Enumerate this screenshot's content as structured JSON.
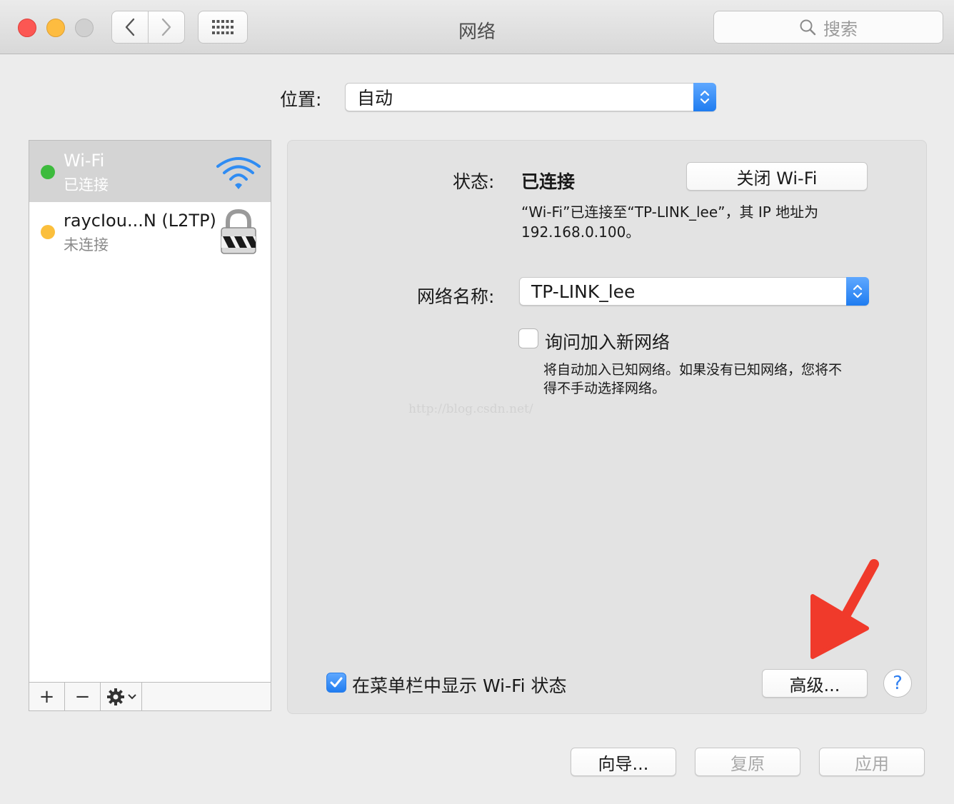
{
  "window": {
    "title": "网络",
    "search_placeholder": "搜索"
  },
  "location": {
    "label": "位置:",
    "value": "自动"
  },
  "services": [
    {
      "name": "Wi-Fi",
      "status": "已连接",
      "status_color": "#3dbb3d",
      "selected": true,
      "icon": "wifi-icon"
    },
    {
      "name": "raycIou...N (L2TP)",
      "status": "未连接",
      "status_color": "#fbbf3c",
      "selected": false,
      "icon": "lock-icon"
    }
  ],
  "sidebar_toolbar": {
    "add": "+",
    "remove": "−"
  },
  "detail": {
    "status_label": "状态:",
    "status_value": "已连接",
    "turn_off_button": "关闭 Wi-Fi",
    "status_description_line1": "“Wi-Fi”已连接至“TP-LINK_lee”，其 IP 地址为",
    "status_description_line2": "192.168.0.100。",
    "network_name_label": "网络名称:",
    "network_name_value": "TP-LINK_lee",
    "ask_join_label": "询问加入新网络",
    "ask_join_desc_line1": "将自动加入已知网络。如果没有已知网络，您将不",
    "ask_join_desc_line2": "得不手动选择网络。",
    "show_in_menubar_label": "在菜单栏中显示 Wi-Fi 状态",
    "advanced_button": "高级...",
    "help_button": "?"
  },
  "watermark": "http://blog.csdn.net/",
  "footer": {
    "assist_button": "向导...",
    "revert_button": "复原",
    "apply_button": "应用"
  },
  "colors": {
    "accent": "#1f7cf0",
    "annotation_arrow": "#f03a2b"
  }
}
